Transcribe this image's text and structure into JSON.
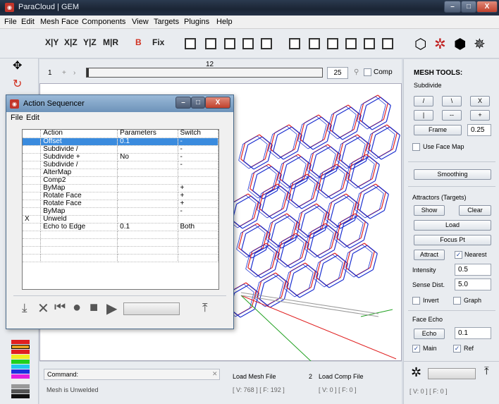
{
  "window": {
    "title": "ParaCloud | GEM",
    "minimize": "–",
    "maximize": "□",
    "close": "X"
  },
  "menu": [
    "File",
    "Edit",
    "Mesh",
    "Face",
    "Components",
    "View",
    "Targets",
    "Plugins",
    "Help"
  ],
  "toolbar": {
    "xy": "X|Y",
    "xz": "X|Z",
    "yz": "Y|Z",
    "mr": "M|R",
    "b": "B",
    "fix": "Fix"
  },
  "frames": {
    "start": "1",
    "current": "12",
    "total": "25",
    "comp_label": "Comp"
  },
  "mesh_tools": {
    "title": "MESH TOOLS:",
    "subdivide_label": "Subdivide",
    "btn_slash": "/",
    "btn_backslash": "\\",
    "btn_x": "X",
    "btn_pipe": "|",
    "btn_dash": "--",
    "btn_plus": "+",
    "frame_btn": "Frame",
    "frame_value": "0.25",
    "use_face_map": "Use Face Map",
    "smoothing_btn": "Smoothing",
    "attractors_label": "Attractors (Targets)",
    "show_btn": "Show",
    "clear_btn": "Clear",
    "load_btn": "Load",
    "focus_btn": "Focus Pt",
    "attract_btn": "Attract",
    "nearest": "Nearest",
    "intensity_label": "Intensity",
    "intensity_value": "0.5",
    "sense_label": "Sense Dist.",
    "sense_value": "5.0",
    "invert": "Invert",
    "graph": "Graph",
    "face_echo_label": "Face Echo",
    "echo_btn": "Echo",
    "echo_value": "0.1",
    "main": "Main",
    "ref": "Ref",
    "status": "[ V: 0 ] [ F: 0 ]"
  },
  "status": {
    "command_label": "Command:",
    "message": "Mesh is Unwelded",
    "load_mesh": "Load Mesh File",
    "mesh_counts": "[ V: 768 ] [ F: 192 ]",
    "comp_num": "2",
    "load_comp": "Load Comp File",
    "comp_counts": "[ V: 0 ] [ F: 0 ]"
  },
  "dialog": {
    "title": "Action Sequencer",
    "menu_file": "File",
    "menu_edit": "Edit",
    "headers": [
      "",
      "Action",
      "Parameters",
      "Switch"
    ],
    "rows": [
      [
        "",
        "Offset",
        "0.1",
        "-"
      ],
      [
        "",
        "Subdivide /",
        "",
        "-"
      ],
      [
        "",
        "Subdivide +",
        "No",
        "-"
      ],
      [
        "",
        "Subdivide /",
        "",
        "-"
      ],
      [
        "",
        "AlterMap",
        "",
        ""
      ],
      [
        "",
        "Comp2",
        "",
        ""
      ],
      [
        "",
        "ByMap",
        "",
        "+"
      ],
      [
        "",
        "Rotate Face",
        "",
        "+"
      ],
      [
        "",
        "Rotate Face",
        "",
        "+"
      ],
      [
        "",
        "ByMap",
        "",
        "-"
      ],
      [
        "X",
        "Unweld",
        "",
        ""
      ],
      [
        "",
        "Echo to Edge",
        "0.1",
        "Both"
      ],
      [
        "",
        "",
        "",
        ""
      ],
      [
        "",
        "",
        "",
        ""
      ],
      [
        "",
        "",
        "",
        ""
      ],
      [
        "",
        "",
        "",
        ""
      ]
    ]
  },
  "colors": {
    "accent": "#3a8bde",
    "red_mesh": "#e02020",
    "blue_mesh": "#1a2fd0"
  }
}
